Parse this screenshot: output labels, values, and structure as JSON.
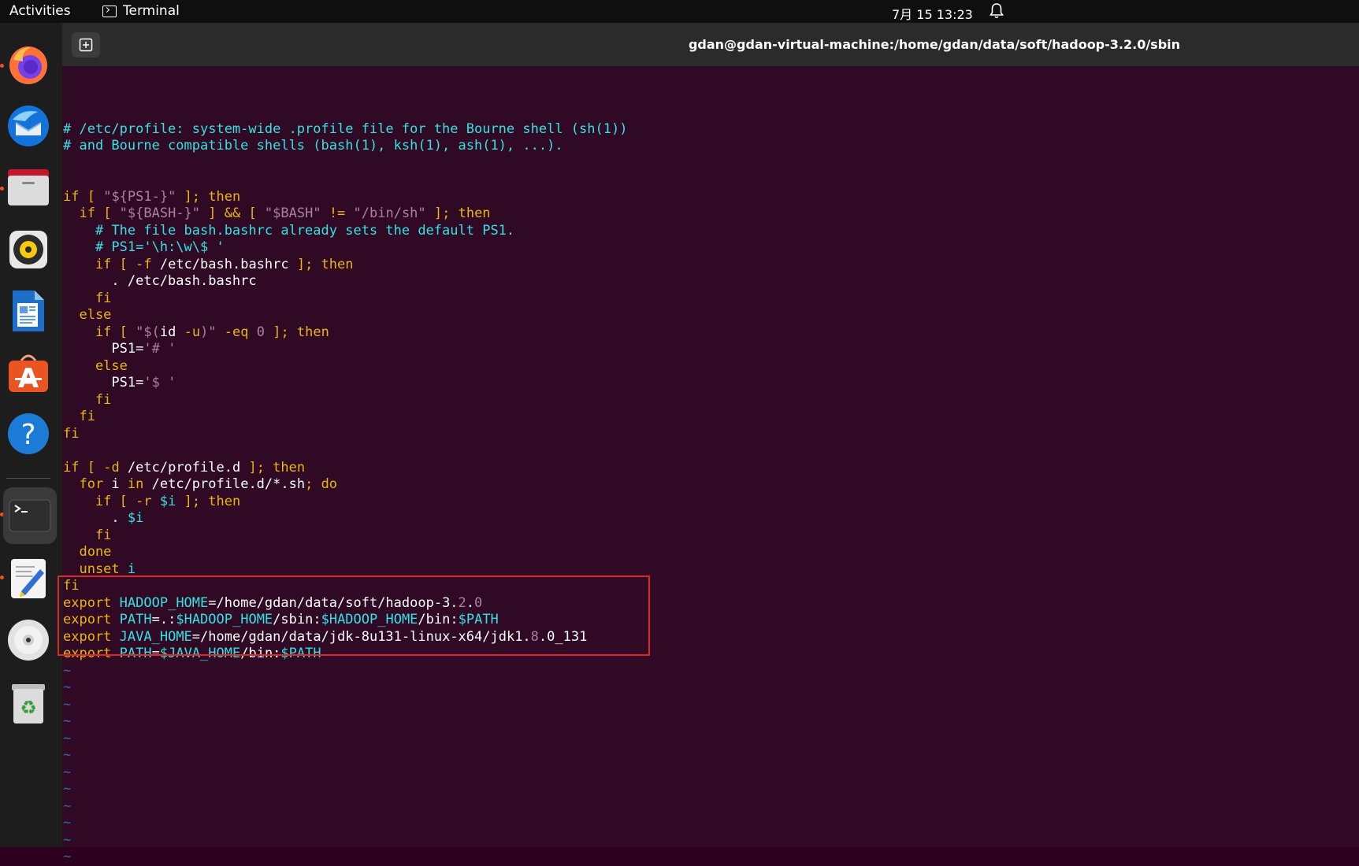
{
  "topbar": {
    "activities": "Activities",
    "app_name": "Terminal",
    "app_icon": "terminal-icon",
    "clock": "7月 15  13:23",
    "bell_icon": "bell-icon"
  },
  "dock": {
    "items": [
      {
        "name": "firefox",
        "icon": "firefox-icon",
        "running": true
      },
      {
        "name": "thunderbird",
        "icon": "mail-icon",
        "running": false
      },
      {
        "name": "files",
        "icon": "folder-icon",
        "running": true
      },
      {
        "name": "rhythmbox",
        "icon": "music-icon",
        "running": false
      },
      {
        "name": "libreoffice-writer",
        "icon": "document-icon",
        "running": false
      },
      {
        "name": "app-center",
        "icon": "store-icon",
        "running": false
      },
      {
        "name": "help",
        "icon": "help-icon",
        "running": false
      },
      {
        "name": "terminal",
        "icon": "terminal-icon",
        "running": true,
        "active": true
      },
      {
        "name": "text-editor",
        "icon": "editor-icon",
        "running": true
      },
      {
        "name": "dvd-drive",
        "icon": "disc-icon",
        "running": false
      },
      {
        "name": "trash",
        "icon": "trash-icon",
        "running": false
      }
    ]
  },
  "window": {
    "title": "gdan@gdan-virtual-machine:/home/gdan/data/soft/hadoop-3.2.0/sbin",
    "new_tab_icon": "new-tab-icon"
  },
  "colors": {
    "terminal_bg": "#300a24",
    "comment": "#34e2e2",
    "keyword": "#e9b60a",
    "string": "#ad7fa8",
    "tilde": "#3465a4",
    "highlight_box": "#e0262b"
  },
  "file_lines": [
    [
      {
        "t": "# /etc/profile: system-wide .profile file for the Bourne shell (sh(1))",
        "c": "comment"
      }
    ],
    [
      {
        "t": "# and Bourne compatible shells (bash(1), ksh(1), ash(1), ...).",
        "c": "comment"
      }
    ],
    [],
    [],
    [
      {
        "t": "if",
        "c": "kw"
      },
      {
        "t": " [ ",
        "c": "kw"
      },
      {
        "t": "\"${PS1-}\"",
        "c": "str"
      },
      {
        "t": " ]; then",
        "c": "kw"
      }
    ],
    [
      {
        "t": "  if",
        "c": "kw"
      },
      {
        "t": " [ ",
        "c": "kw"
      },
      {
        "t": "\"${BASH-}\"",
        "c": "str"
      },
      {
        "t": " ] && [ ",
        "c": "kw"
      },
      {
        "t": "\"$BASH\"",
        "c": "str"
      },
      {
        "t": " != ",
        "c": "kw"
      },
      {
        "t": "\"/bin/sh\"",
        "c": "str"
      },
      {
        "t": " ]; then",
        "c": "kw"
      }
    ],
    [
      {
        "t": "    # The file bash.bashrc already sets the default PS1.",
        "c": "comment"
      }
    ],
    [
      {
        "t": "    # PS1='\\h:\\w\\$ '",
        "c": "comment"
      }
    ],
    [
      {
        "t": "    if",
        "c": "kw"
      },
      {
        "t": " [ ",
        "c": "kw"
      },
      {
        "t": "-f",
        "c": "kw"
      },
      {
        "t": " /etc/bash.bashrc",
        "c": "id"
      },
      {
        "t": " ]; then",
        "c": "kw"
      }
    ],
    [
      {
        "t": "      . /etc/bash.bashrc",
        "c": "id"
      }
    ],
    [
      {
        "t": "    fi",
        "c": "kw"
      }
    ],
    [
      {
        "t": "  else",
        "c": "kw"
      }
    ],
    [
      {
        "t": "    if",
        "c": "kw"
      },
      {
        "t": " [ ",
        "c": "kw"
      },
      {
        "t": "\"$(",
        "c": "str"
      },
      {
        "t": "id",
        "c": "id"
      },
      {
        "t": " -u",
        "c": "kw"
      },
      {
        "t": ")\"",
        "c": "str"
      },
      {
        "t": " -eq ",
        "c": "kw"
      },
      {
        "t": "0",
        "c": "num"
      },
      {
        "t": " ]; then",
        "c": "kw"
      }
    ],
    [
      {
        "t": "      PS1=",
        "c": "id"
      },
      {
        "t": "'# '",
        "c": "str"
      }
    ],
    [
      {
        "t": "    else",
        "c": "kw"
      }
    ],
    [
      {
        "t": "      PS1=",
        "c": "id"
      },
      {
        "t": "'$ '",
        "c": "str"
      }
    ],
    [
      {
        "t": "    fi",
        "c": "kw"
      }
    ],
    [
      {
        "t": "  fi",
        "c": "kw"
      }
    ],
    [
      {
        "t": "fi",
        "c": "kw"
      }
    ],
    [],
    [
      {
        "t": "if",
        "c": "kw"
      },
      {
        "t": " [ ",
        "c": "kw"
      },
      {
        "t": "-d",
        "c": "kw"
      },
      {
        "t": " /etc/profile.d",
        "c": "id"
      },
      {
        "t": " ]; then",
        "c": "kw"
      }
    ],
    [
      {
        "t": "  for",
        "c": "kw"
      },
      {
        "t": " i ",
        "c": "id"
      },
      {
        "t": "in",
        "c": "kw"
      },
      {
        "t": " /etc/profile.d/*.sh",
        "c": "id"
      },
      {
        "t": "; do",
        "c": "kw"
      }
    ],
    [
      {
        "t": "    if",
        "c": "kw"
      },
      {
        "t": " [ ",
        "c": "kw"
      },
      {
        "t": "-r",
        "c": "kw"
      },
      {
        "t": " $i",
        "c": "var"
      },
      {
        "t": " ]; then",
        "c": "kw"
      }
    ],
    [
      {
        "t": "      . ",
        "c": "id"
      },
      {
        "t": "$i",
        "c": "var"
      }
    ],
    [
      {
        "t": "    fi",
        "c": "kw"
      }
    ],
    [
      {
        "t": "  done",
        "c": "kw"
      }
    ],
    [
      {
        "t": "  unset",
        "c": "kw"
      },
      {
        "t": " i",
        "c": "var"
      }
    ],
    [
      {
        "t": "fi",
        "c": "kw"
      }
    ],
    [
      {
        "t": "export",
        "c": "kw"
      },
      {
        "t": " ",
        "c": "id"
      },
      {
        "t": "HADOOP_HOME",
        "c": "var"
      },
      {
        "t": "=/home/gdan/data/soft/hadoop-3.",
        "c": "id"
      },
      {
        "t": "2",
        "c": "num"
      },
      {
        "t": ".",
        "c": "id"
      },
      {
        "t": "0",
        "c": "num"
      }
    ],
    [
      {
        "t": "export",
        "c": "kw"
      },
      {
        "t": " ",
        "c": "id"
      },
      {
        "t": "PATH",
        "c": "var"
      },
      {
        "t": "=.:",
        "c": "id"
      },
      {
        "t": "$HADOOP_HOME",
        "c": "var"
      },
      {
        "t": "/sbin:",
        "c": "id"
      },
      {
        "t": "$HADOOP_HOME",
        "c": "var"
      },
      {
        "t": "/bin:",
        "c": "id"
      },
      {
        "t": "$PATH",
        "c": "var"
      }
    ],
    [
      {
        "t": "export",
        "c": "kw"
      },
      {
        "t": " ",
        "c": "id"
      },
      {
        "t": "JAVA_HOME",
        "c": "var"
      },
      {
        "t": "=/home/gdan/data/jdk-8u131-linux-x64/jdk1.",
        "c": "id"
      },
      {
        "t": "8",
        "c": "num"
      },
      {
        "t": ".0_131",
        "c": "id"
      }
    ],
    [
      {
        "t": "export",
        "c": "kw"
      },
      {
        "t": " ",
        "c": "id"
      },
      {
        "t": "PATH",
        "c": "var"
      },
      {
        "t": "=",
        "c": "id"
      },
      {
        "t": "$JAVA_HOME",
        "c": "var"
      },
      {
        "t": "/bin:",
        "c": "id"
      },
      {
        "t": "$PATH",
        "c": "var"
      }
    ],
    [
      {
        "t": "~",
        "c": "tilde"
      }
    ],
    [
      {
        "t": "~",
        "c": "tilde"
      }
    ],
    [
      {
        "t": "~",
        "c": "tilde"
      }
    ],
    [
      {
        "t": "~",
        "c": "tilde"
      }
    ],
    [
      {
        "t": "~",
        "c": "tilde"
      }
    ],
    [
      {
        "t": "~",
        "c": "tilde"
      }
    ],
    [
      {
        "t": "~",
        "c": "tilde"
      }
    ],
    [
      {
        "t": "~",
        "c": "tilde"
      }
    ],
    [
      {
        "t": "~",
        "c": "tilde"
      }
    ],
    [
      {
        "t": "~",
        "c": "tilde"
      }
    ],
    [
      {
        "t": "~",
        "c": "tilde"
      }
    ],
    [
      {
        "t": "~",
        "c": "tilde"
      }
    ]
  ]
}
